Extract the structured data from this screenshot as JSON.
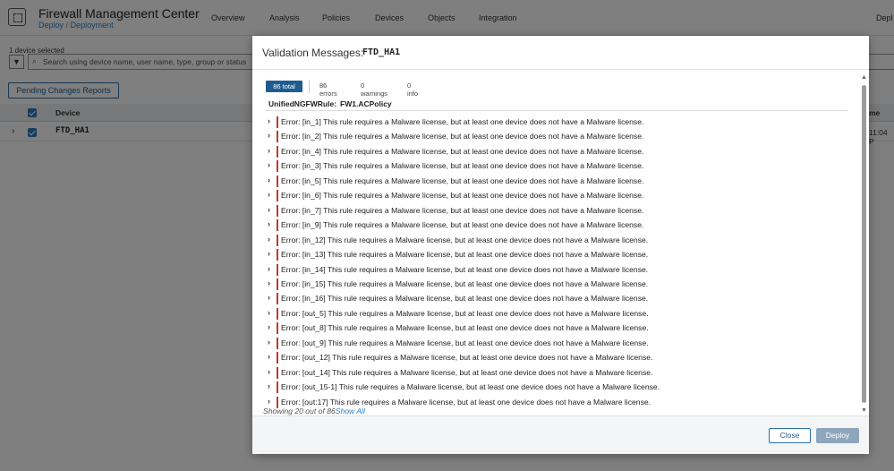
{
  "app": {
    "title": "Firewall Management Center",
    "breadcrumb_root": "Deploy",
    "breadcrumb_sep": "/",
    "breadcrumb_current": "Deployment",
    "nav": [
      "Overview",
      "Analysis",
      "Policies",
      "Devices",
      "Objects",
      "Integration",
      "Depl"
    ]
  },
  "list": {
    "selected_count": "1 device selected",
    "search_placeholder": "Search using device name, user name, type, group or status",
    "pending_button": "Pending Changes Reports",
    "col_device": "Device",
    "col_time": "me",
    "row": {
      "device": "FTD_HA1",
      "time": "11:04 P"
    }
  },
  "modal": {
    "title": "Validation Messages:",
    "device": "FTD_HA1",
    "filters": {
      "total": "86 total",
      "errors": "86 errors",
      "warnings": "0 warnings",
      "info": "0 info"
    },
    "policy_type": "UnifiedNGFWRule:",
    "policy_name": "FW1.ACPolicy",
    "messages": [
      "Error: [in_1] This rule requires a Malware license, but at least one device does not have a Malware license.",
      "Error: [in_2] This rule requires a Malware license, but at least one device does not have a Malware license.",
      "Error: [in_4] This rule requires a Malware license, but at least one device does not have a Malware license.",
      "Error: [in_3] This rule requires a Malware license, but at least one device does not have a Malware license.",
      "Error: [in_5] This rule requires a Malware license, but at least one device does not have a Malware license.",
      "Error: [in_6] This rule requires a Malware license, but at least one device does not have a Malware license.",
      "Error: [in_7] This rule requires a Malware license, but at least one device does not have a Malware license.",
      "Error: [in_9] This rule requires a Malware license, but at least one device does not have a Malware license.",
      "Error: [in_12] This rule requires a Malware license, but at least one device does not have a Malware license.",
      "Error: [in_13] This rule requires a Malware license, but at least one device does not have a Malware license.",
      "Error: [in_14] This rule requires a Malware license, but at least one device does not have a Malware license.",
      "Error: [in_15] This rule requires a Malware license, but at least one device does not have a Malware license.",
      "Error: [in_16] This rule requires a Malware license, but at least one device does not have a Malware license.",
      "Error: [out_5] This rule requires a Malware license, but at least one device does not have a Malware license.",
      "Error: [out_8] This rule requires a Malware license, but at least one device does not have a Malware license.",
      "Error: [out_9] This rule requires a Malware license, but at least one device does not have a Malware license.",
      "Error: [out_12] This rule requires a Malware license, but at least one device does not have a Malware license.",
      "Error: [out_14] This rule requires a Malware license, but at least one device does not have a Malware license.",
      "Error: [out_15-1] This rule requires a Malware license, but at least one device does not have a Malware license.",
      "Error: [out:17] This rule requires a Malware license, but at least one device does not have a Malware license."
    ],
    "showing_text": "Showing 20 out of 86",
    "show_all": "Show All",
    "close_button": "Close",
    "deploy_button": "Deploy"
  },
  "icons": {
    "expand": "chevron-right-icon",
    "filter": "filter-icon",
    "search": "search-icon"
  },
  "colors": {
    "accent": "#1f5c8f",
    "error_bar": "#c0392b",
    "link": "#2a7fc4"
  }
}
